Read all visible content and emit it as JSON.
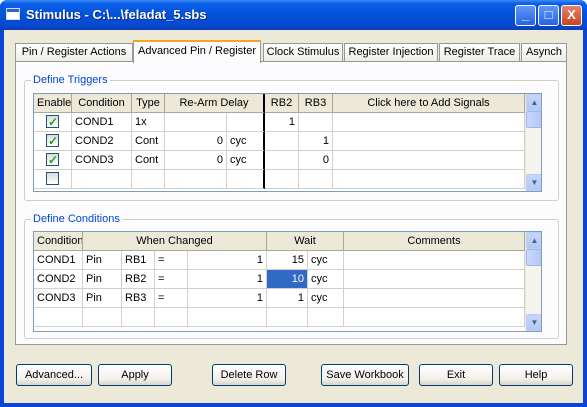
{
  "window": {
    "title": "Stimulus - C:\\...\\feladat_5.sbs"
  },
  "title_buttons": [
    "_",
    "□",
    "X"
  ],
  "tabs": [
    {
      "label": "Pin / Register Actions",
      "active": false
    },
    {
      "label": "Advanced Pin / Register",
      "active": true
    },
    {
      "label": "Clock Stimulus",
      "active": false
    },
    {
      "label": "Register Injection",
      "active": false
    },
    {
      "label": "Register Trace",
      "active": false
    },
    {
      "label": "Asynch",
      "active": false
    }
  ],
  "triggers": {
    "group_title": "Define Triggers",
    "headers": [
      "Enable",
      "Condition",
      "Type",
      "Re-Arm Delay",
      "RB2",
      "RB3",
      "Click here to Add Signals"
    ],
    "rows": [
      {
        "enabled": true,
        "condition": "COND1",
        "type": "1x",
        "delay": "",
        "unit": "",
        "rb2": "1",
        "rb3": ""
      },
      {
        "enabled": true,
        "condition": "COND2",
        "type": "Cont",
        "delay": "0",
        "unit": "cyc",
        "rb2": "",
        "rb3": "1"
      },
      {
        "enabled": true,
        "condition": "COND3",
        "type": "Cont",
        "delay": "0",
        "unit": "cyc",
        "rb2": "",
        "rb3": "0"
      },
      {
        "enabled": false,
        "condition": "",
        "type": "",
        "delay": "",
        "unit": "",
        "rb2": "",
        "rb3": ""
      }
    ]
  },
  "conditions": {
    "group_title": "Define Conditions",
    "headers": [
      "Condition",
      "When Changed",
      "Wait",
      "Comments"
    ],
    "rows": [
      {
        "condition": "COND1",
        "kind": "Pin",
        "signal": "RB1",
        "op": "=",
        "value": "1",
        "wait": "15",
        "unit": "cyc",
        "selected": false
      },
      {
        "condition": "COND2",
        "kind": "Pin",
        "signal": "RB2",
        "op": "=",
        "value": "1",
        "wait": "10",
        "unit": "cyc",
        "selected": true
      },
      {
        "condition": "COND3",
        "kind": "Pin",
        "signal": "RB3",
        "op": "=",
        "value": "1",
        "wait": "1",
        "unit": "cyc",
        "selected": false
      }
    ]
  },
  "buttons": {
    "advanced": "Advanced...",
    "apply": "Apply",
    "delete_row": "Delete Row",
    "save_workbook": "Save Workbook",
    "exit": "Exit",
    "help": "Help"
  },
  "colors": {
    "title_bar": "#0a5ee8",
    "selection": "#316ac5",
    "group_title": "#0046d5",
    "tab_accent": "#f6a51c"
  }
}
